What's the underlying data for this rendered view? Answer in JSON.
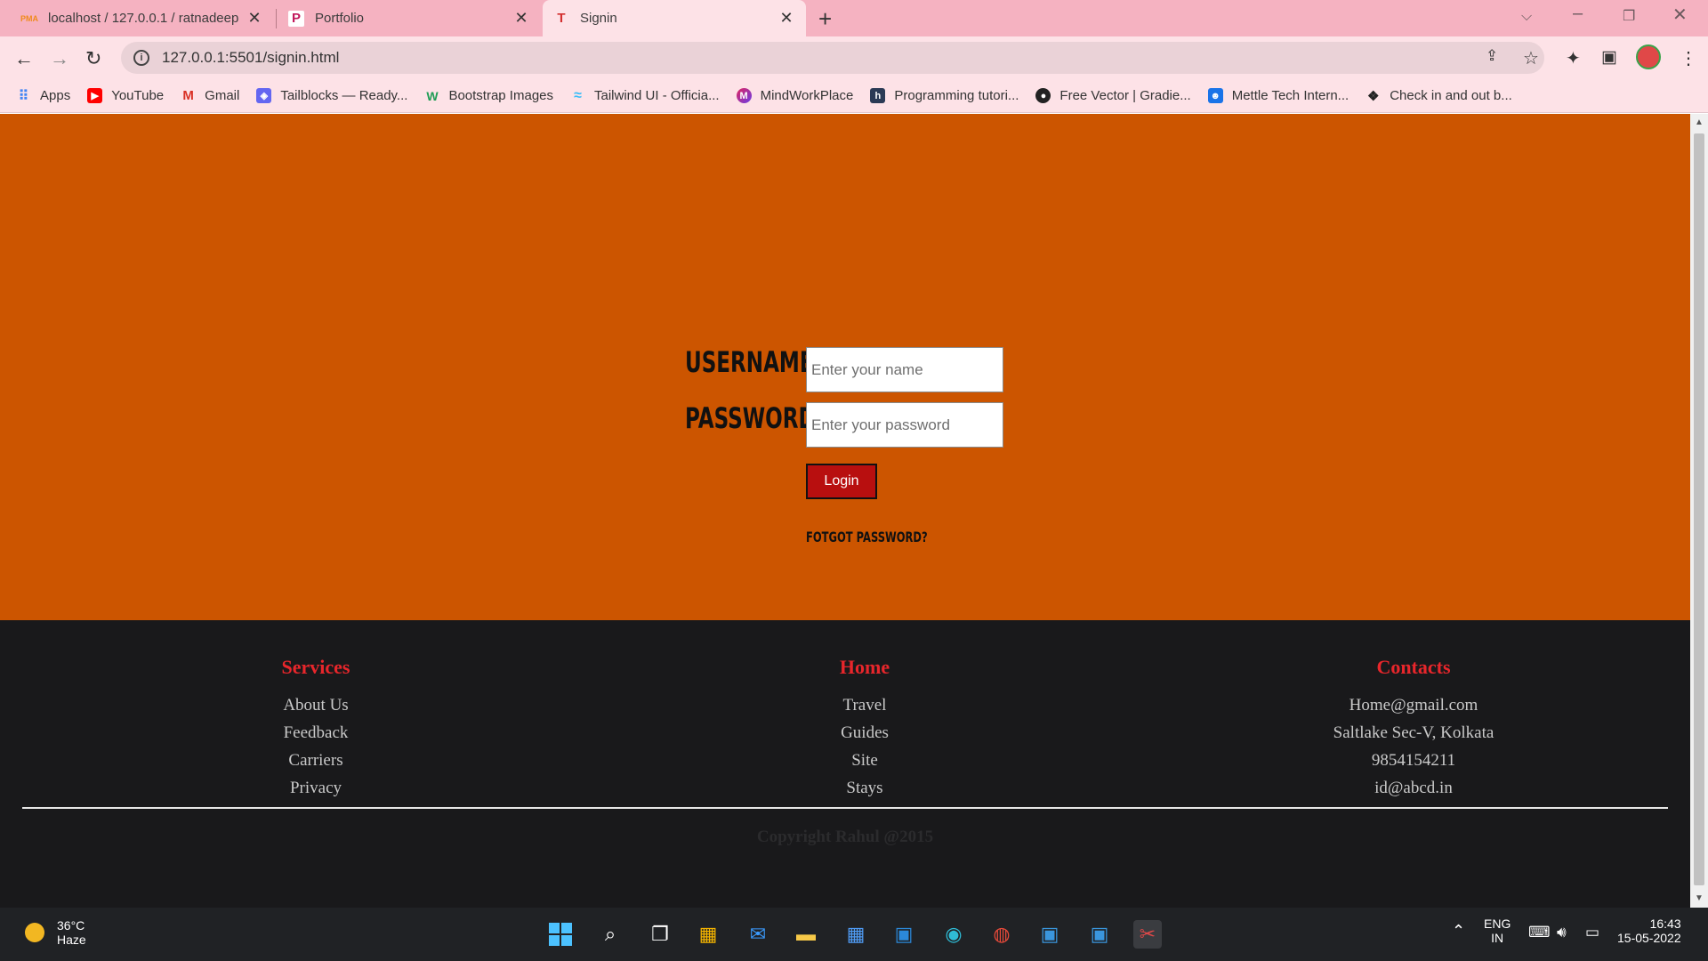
{
  "browser": {
    "tabs": [
      {
        "title": "localhost / 127.0.0.1 / ratnadeep",
        "icon": "phpmyadmin-icon",
        "active": false
      },
      {
        "title": "Portfolio",
        "icon": "portfolio-icon",
        "active": false
      },
      {
        "title": "Signin",
        "icon": "signin-icon",
        "active": true
      }
    ],
    "url": "127.0.0.1:5501/signin.html",
    "bookmarks": [
      {
        "label": "Apps",
        "icon": "apps-icon",
        "color": "#4285f4"
      },
      {
        "label": "YouTube",
        "icon": "youtube-icon",
        "color": "#ff0000"
      },
      {
        "label": "Gmail",
        "icon": "gmail-icon",
        "color": "#d93025"
      },
      {
        "label": "Tailblocks — Ready...",
        "icon": "tailblocks-icon",
        "color": "#6366f1"
      },
      {
        "label": "Bootstrap Images",
        "icon": "bootstrap-images-icon",
        "color": "#1f9d55"
      },
      {
        "label": "Tailwind UI - Officia...",
        "icon": "tailwind-icon",
        "color": "#38bdf8"
      },
      {
        "label": "MindWorkPlace",
        "icon": "mindworkplace-icon",
        "color": "#a32bd1"
      },
      {
        "label": "Programming tutori...",
        "icon": "programming-icon",
        "color": "#2b3a55"
      },
      {
        "label": "Free Vector | Gradie...",
        "icon": "freepik-icon",
        "color": "#222222"
      },
      {
        "label": "Mettle Tech Intern...",
        "icon": "mettle-icon",
        "color": "#1a73e8"
      },
      {
        "label": "Check in and out b...",
        "icon": "checkin-icon",
        "color": "#333333"
      }
    ]
  },
  "form": {
    "username_label": "USERNAME:",
    "username_placeholder": "Enter your name",
    "password_label": "PASSWORD:",
    "password_placeholder": "Enter your password",
    "login_label": "Login",
    "forgot_label": "FOTGOT PASSWORD?"
  },
  "footer": {
    "columns": [
      {
        "heading": "Services",
        "items": [
          "About Us",
          "Feedback",
          "Carriers",
          "Privacy"
        ]
      },
      {
        "heading": "Home",
        "items": [
          "Travel",
          "Guides",
          "Site",
          "Stays"
        ]
      },
      {
        "heading": "Contacts",
        "items": [
          "Home@gmail.com",
          "Saltlake Sec-V, Kolkata",
          "9854154211",
          "id@abcd.in"
        ]
      }
    ],
    "copyright": "Copyright Rahul @2015"
  },
  "taskbar": {
    "weather_temp": "36°C",
    "weather_desc": "Haze",
    "lang_line1": "ENG",
    "lang_line2": "IN",
    "time": "16:43",
    "date": "15-05-2022"
  },
  "colors": {
    "hero_bg": "#cc5500",
    "footer_bg": "#19191b",
    "footer_heading": "#e8262b",
    "login_button": "#b80f0f"
  }
}
